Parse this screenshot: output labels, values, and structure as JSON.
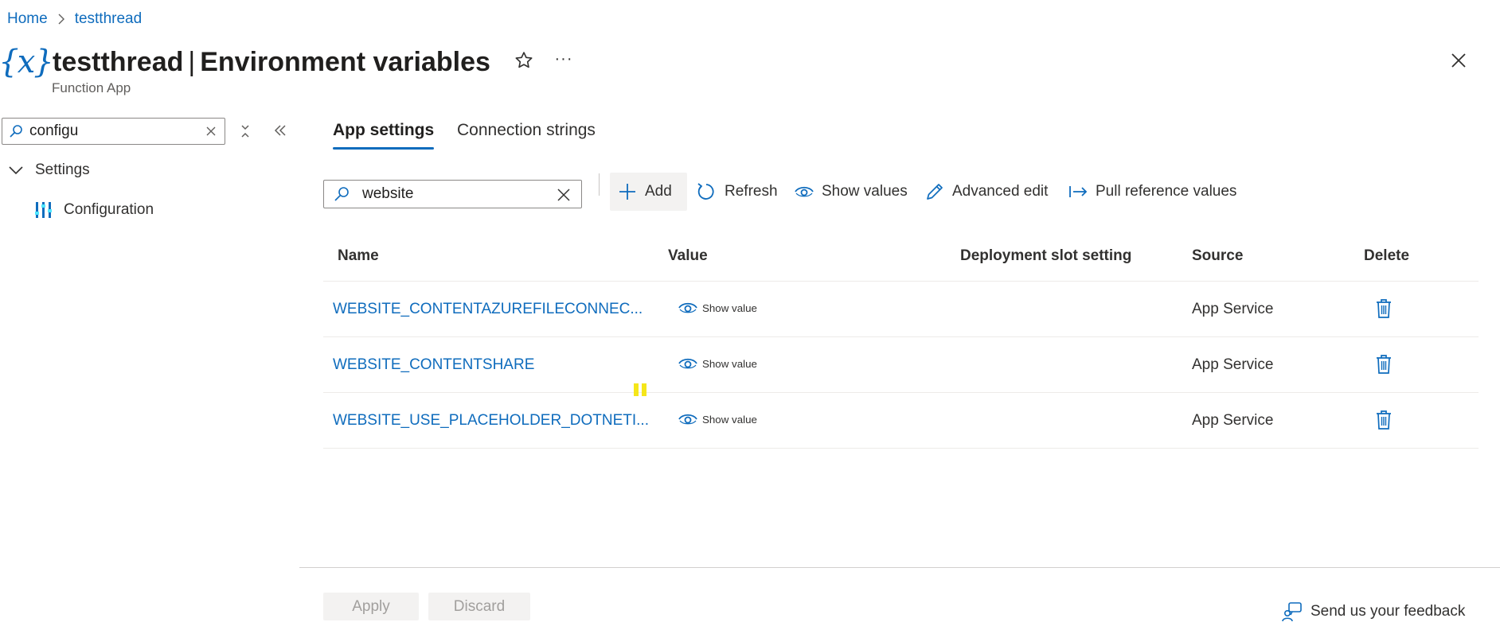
{
  "breadcrumb": {
    "home": "Home",
    "resource": "testthread"
  },
  "header": {
    "icon_glyph": "{x}",
    "resource_name": "testthread",
    "separator": "|",
    "page_name": "Environment variables",
    "subtitle": "Function App",
    "more_glyph": "···"
  },
  "nav": {
    "search_value": "configu",
    "group_label": "Settings",
    "item_label": "Configuration"
  },
  "tabs": [
    {
      "label": "App settings",
      "selected": true
    },
    {
      "label": "Connection strings",
      "selected": false
    }
  ],
  "toolbar": {
    "filter_value": "website",
    "add": "Add",
    "refresh": "Refresh",
    "show_values": "Show values",
    "advanced_edit": "Advanced edit",
    "pull_reference": "Pull reference values"
  },
  "table": {
    "columns": [
      "Name",
      "Value",
      "Deployment slot setting",
      "Source",
      "Delete"
    ],
    "rows": [
      {
        "name": "WEBSITE_CONTENTAZUREFILECONNEC...",
        "value": "Show value",
        "source": "App Service"
      },
      {
        "name": "WEBSITE_CONTENTSHARE",
        "value": "Show value",
        "source": "App Service"
      },
      {
        "name": "WEBSITE_USE_PLACEHOLDER_DOTNETI...",
        "value": "Show value",
        "source": "App Service"
      }
    ]
  },
  "footer": {
    "apply": "Apply",
    "discard": "Discard",
    "feedback": "Send us your feedback"
  },
  "colors": {
    "accent": "#0f6cbd",
    "text": "#323130",
    "disabled_bg": "#f3f2f1",
    "disabled_text": "#a19f9d"
  }
}
